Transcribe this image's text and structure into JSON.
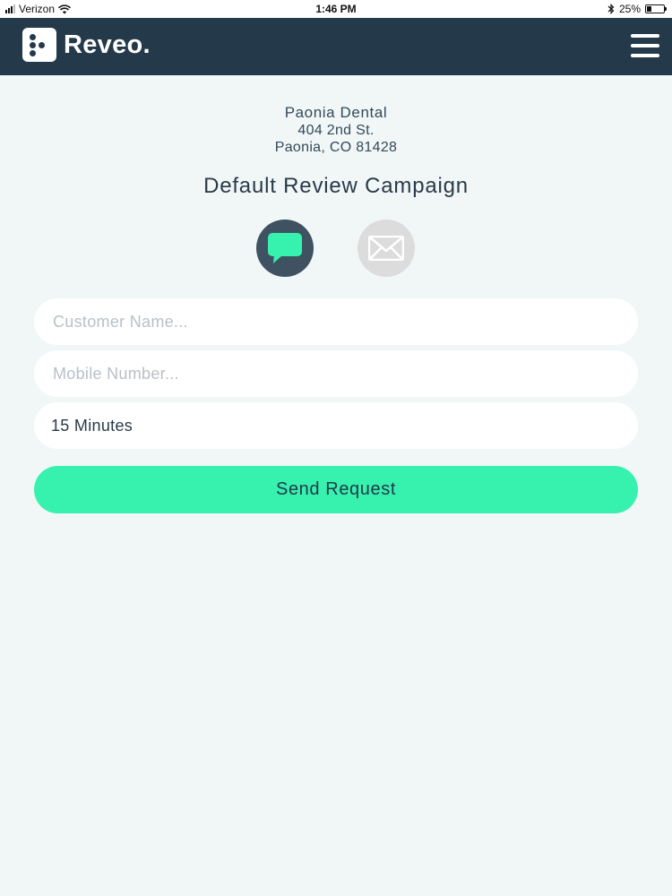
{
  "status_bar": {
    "carrier": "Verizon",
    "time": "1:46 PM",
    "battery": "25%",
    "battery_level": 0.25,
    "icons": [
      "signal-icon",
      "wifi-icon",
      "bluetooth-icon",
      "battery-icon"
    ]
  },
  "header": {
    "brand": "Reveo.",
    "logo_icon": "dice-logo-icon",
    "menu_icon": "hamburger-menu-icon"
  },
  "business": {
    "name": "Paonia Dental",
    "address_line1": "404 2nd St.",
    "address_line2": "Paonia, CO 81428"
  },
  "campaign": {
    "title": "Default Review Campaign"
  },
  "channels": {
    "selected": "sms",
    "items": [
      {
        "id": "sms",
        "icon": "chat-bubble-icon",
        "color": "#3f5261"
      },
      {
        "id": "email",
        "icon": "envelope-icon",
        "color": "#dcdcdc"
      }
    ]
  },
  "form": {
    "customer_name": {
      "value": "",
      "placeholder": "Customer Name..."
    },
    "mobile_number": {
      "value": "",
      "placeholder": "Mobile Number..."
    },
    "delay": {
      "value": "15 Minutes"
    },
    "submit_label": "Send Request"
  },
  "colors": {
    "header_bg": "#24394a",
    "page_bg": "#f1f7f7",
    "accent": "#36f2ae"
  }
}
